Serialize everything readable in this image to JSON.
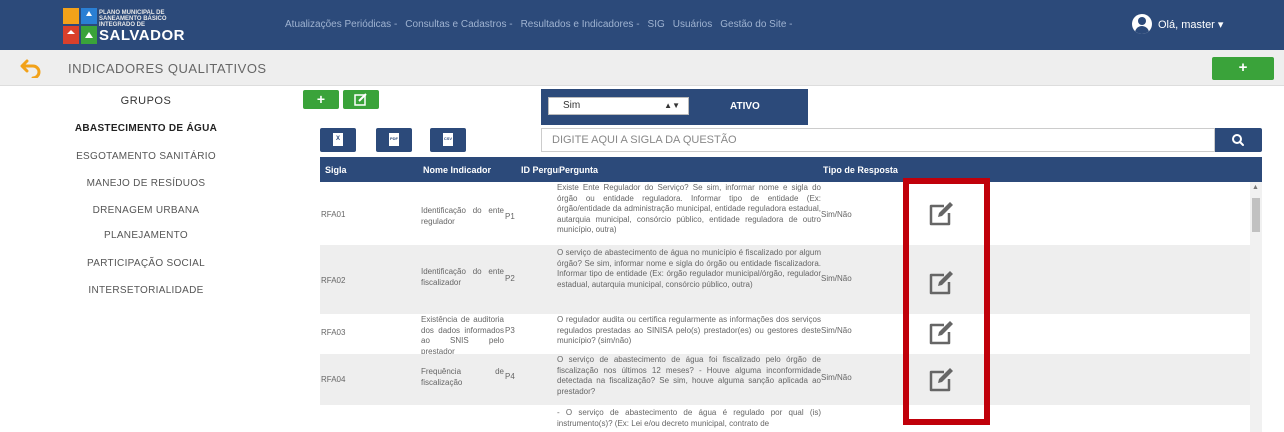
{
  "navbar": {
    "logo_small": "PLANO MUNICIPAL DE SANEAMENTO BÁSICO INTEGRADO DE",
    "logo_big": "SALVADOR",
    "menu": [
      "Atualizações Periódicas -",
      "Consultas e Cadastros -",
      "Resultados e Indicadores -",
      "SIG",
      "Usuários",
      "Gestão do Site -"
    ],
    "user_label": "Olá, master ▾"
  },
  "titlebar": {
    "title": "INDICADORES QUALITATIVOS",
    "add_label": "+"
  },
  "sidebar": {
    "title": "GRUPOS",
    "items": [
      {
        "label": "ABASTECIMENTO DE ÁGUA"
      },
      {
        "label": "ESGOTAMENTO SANITÁRIO"
      },
      {
        "label": "MANEJO DE RESÍDUOS"
      },
      {
        "label": "DRENAGEM URBANA"
      },
      {
        "label": "PLANEJAMENTO"
      },
      {
        "label": "PARTICIPAÇÃO SOCIAL"
      },
      {
        "label": "INTERSETORIALIDADE"
      }
    ]
  },
  "controls": {
    "add_label": "+",
    "select_value": "Sim",
    "ativo_label": "ATIVO",
    "search_placeholder": "DIGITE AQUI A SIGLA DA QUESTÃO",
    "export_labels": [
      "X",
      "PDF",
      "CSV"
    ]
  },
  "table": {
    "headers": [
      "Sigla",
      "Nome Indicador",
      "ID Pergunta",
      "Pergunta",
      "Tipo de Resposta"
    ],
    "rows": [
      {
        "sigla": "RFA01",
        "nome": "Identificação do ente regulador",
        "id": "P1",
        "pergunta": "Existe Ente Regulador do Serviço? Se sim, informar nome e sigla do órgão ou entidade reguladora. Informar tipo de entidade (Ex: órgão/entidade da administração municipal, entidade reguladora estadual, autarquia municipal, consórcio público, entidade reguladora de outro município, outra)",
        "tipo": "Sim/Não"
      },
      {
        "sigla": "RFA02",
        "nome": "Identificação do ente fiscalizador",
        "id": "P2",
        "pergunta": "O serviço de abastecimento de água no município é fiscalizado por algum órgão? Se sim, informar nome e sigla do órgão ou entidade fiscalizadora. Informar tipo de entidade (Ex: órgão regulador municipal/órgão, regulador estadual, autarquia municipal, consórcio público, outra)",
        "tipo": "Sim/Não"
      },
      {
        "sigla": "RFA03",
        "nome": "Existência de auditoria dos dados informados ao SNIS pelo prestador",
        "id": "P3",
        "pergunta": "O regulador audita ou certifica regularmente as informações dos serviços regulados prestadas ao SINISA pelo(s) prestador(es) ou gestores deste município? (sim/não)",
        "tipo": "Sim/Não"
      },
      {
        "sigla": "RFA04",
        "nome": "Frequência de fiscalização",
        "id": "P4",
        "pergunta": "O serviço de abastecimento de água foi fiscalizado pelo órgão de fiscalização nos últimos 12 meses? - Houve alguma inconformidade detectada na fiscalização? Se sim, houve alguma sanção aplicada ao prestador?",
        "tipo": "Sim/Não"
      },
      {
        "sigla": "",
        "nome": "",
        "id": "",
        "pergunta": "- O serviço de abastecimento de água é regulado por qual (is) instrumento(s)? (Ex: Lei e/ou decreto municipal, contrato de",
        "tipo": ""
      }
    ]
  },
  "colors": {
    "navy": "#2c4a7a",
    "green": "#3aa33a",
    "highlight": "#c0000a"
  }
}
